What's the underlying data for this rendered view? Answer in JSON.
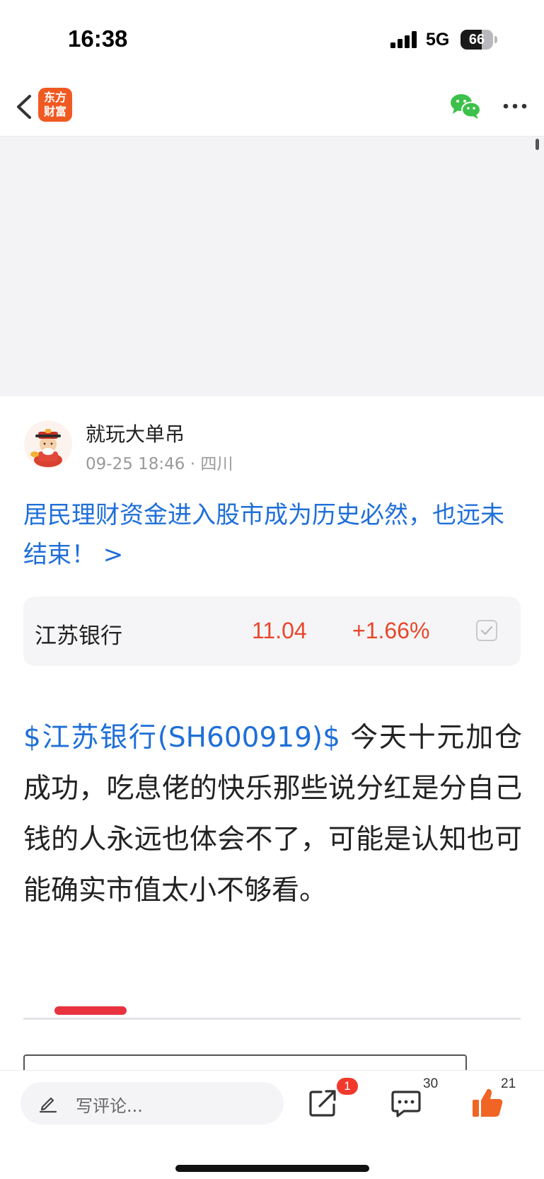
{
  "status_bar": {
    "time": "16:38",
    "network": "5G",
    "battery": "66",
    "battery_level": 0.66
  },
  "nav": {
    "app_logo_line1": "东方",
    "app_logo_line2": "财富",
    "icons": [
      "chevron-left-icon",
      "wechat-icon",
      "more-dots-icon"
    ]
  },
  "post": {
    "author": {
      "name": "就玩大单吊",
      "time": "09-25 18:46",
      "location": "四川"
    },
    "headline": "居民理财资金进入股市成为历史必然，也远未结束！ >",
    "stock": {
      "name": "江苏银行",
      "price": "11.04",
      "change": "+1.66%",
      "color": "#e8472c"
    },
    "body_link": "$江苏银行(SH600919)$",
    "body_text": " 今天十元加仓成功，吃息佬的快乐那些说分红是分自己钱的人永远也体会不了，可能是认知也可能确实市值太小不够看。"
  },
  "bottom_bar": {
    "comment_placeholder": "写评论...",
    "share_badge": "1",
    "comments_count": "30",
    "likes_count": "21"
  },
  "colors": {
    "link_blue": "#1f6fd8",
    "brand_orange": "#f05a22",
    "up_red": "#e8472c",
    "wechat_green": "#3cc14a"
  }
}
